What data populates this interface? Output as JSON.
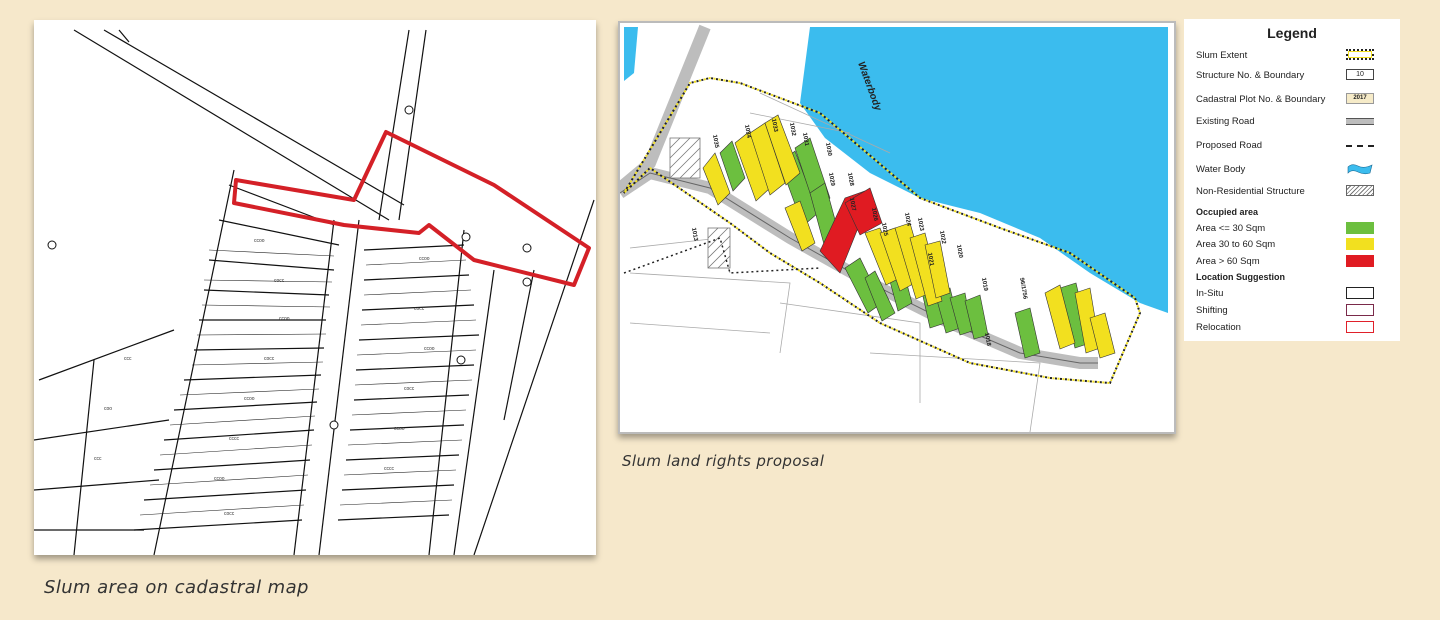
{
  "captions": {
    "cadastral": "Slum area on cadastral map",
    "proposal": "Slum land rights proposal"
  },
  "map": {
    "waterbody_label": "Waterbody",
    "plot_numbers": [
      "1035",
      "1034",
      "1033",
      "1032",
      "1031",
      "1030",
      "1029",
      "1028",
      "1027",
      "1026",
      "1025",
      "1024",
      "1023",
      "1022",
      "1021",
      "1020",
      "1019",
      "96/1756",
      "1018",
      "1013"
    ]
  },
  "legend": {
    "title": "Legend",
    "items": [
      {
        "label": "Slum Extent",
        "symbol": "dotted-yellow-box-icon"
      },
      {
        "label": "Structure No. & Boundary",
        "symbol": "numbered-box-icon",
        "value": "10"
      },
      {
        "label": "Cadastral Plot No. & Boundary",
        "symbol": "cadastral-box-icon",
        "value": "2017"
      },
      {
        "label": "Existing Road",
        "symbol": "grey-road-icon"
      },
      {
        "label": "Proposed Road",
        "symbol": "dash-dot-line-icon"
      },
      {
        "label": "Water Body",
        "symbol": "water-shape-icon"
      },
      {
        "label": "Non-Residential Structure",
        "symbol": "hatched-box-icon"
      }
    ],
    "occupied_heading": "Occupied area",
    "occupied": [
      {
        "label": "Area <= 30 Sqm",
        "color": "#6cbf3f"
      },
      {
        "label": "Area 30 to 60 Sqm",
        "color": "#f2e01f"
      },
      {
        "label": "Area > 60 Sqm",
        "color": "#e01b22"
      }
    ],
    "location_heading": "Location Suggestion",
    "location": [
      {
        "label": "In-Situ",
        "color": "#222222"
      },
      {
        "label": "Shifting",
        "color": "#7a2a4a"
      },
      {
        "label": "Relocation",
        "color": "#e0202a"
      }
    ]
  },
  "colors": {
    "background": "#f6e8cb",
    "water": "#3bbcee",
    "slum_boundary": "#d42027"
  }
}
